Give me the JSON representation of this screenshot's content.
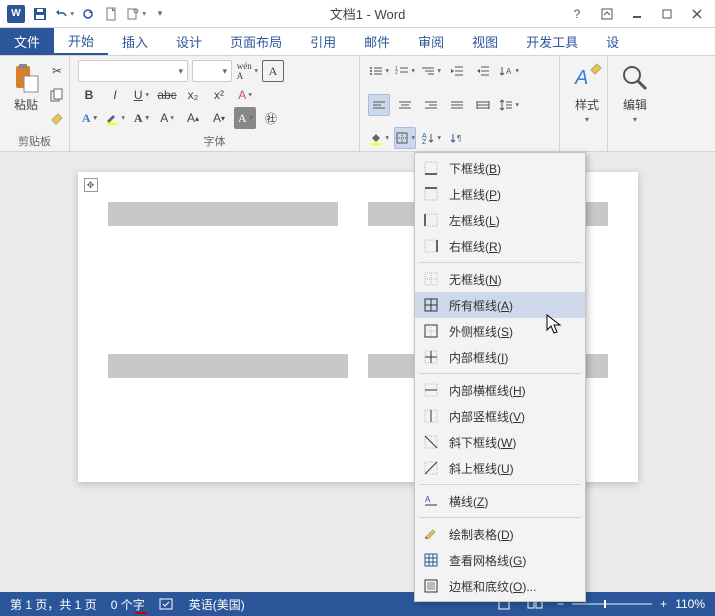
{
  "titlebar": {
    "title": "文档1 - Word"
  },
  "tabs": {
    "file": "文件",
    "home": "开始",
    "insert": "插入",
    "design": "设计",
    "layout": "页面布局",
    "references": "引用",
    "mail": "邮件",
    "review": "审阅",
    "view": "视图",
    "dev": "开发工具",
    "settings": "设"
  },
  "groups": {
    "clipboard": {
      "label": "剪贴板",
      "paste": "粘贴"
    },
    "font": {
      "label": "字体"
    },
    "styles": {
      "label": "样式",
      "btn": "样式"
    },
    "edit": {
      "label": "",
      "btn": "编辑"
    }
  },
  "statusbar": {
    "page": "第 1 页，共 1 页",
    "words": "0 个字",
    "lang": "英语(美国)",
    "zoom": "110%"
  },
  "border_menu": [
    {
      "id": "bottom",
      "label": "下框线",
      "accel": "B",
      "icon": "bb"
    },
    {
      "id": "top",
      "label": "上框线",
      "accel": "P",
      "icon": "bt"
    },
    {
      "id": "left",
      "label": "左框线",
      "accel": "L",
      "icon": "bl"
    },
    {
      "id": "right",
      "label": "右框线",
      "accel": "R",
      "icon": "br"
    },
    {
      "id": "sep"
    },
    {
      "id": "none",
      "label": "无框线",
      "accel": "N",
      "icon": "bn"
    },
    {
      "id": "all",
      "label": "所有框线",
      "accel": "A",
      "icon": "ba",
      "hover": true
    },
    {
      "id": "outside",
      "label": "外侧框线",
      "accel": "S",
      "icon": "bo"
    },
    {
      "id": "inside",
      "label": "内部框线",
      "accel": "I",
      "icon": "bi"
    },
    {
      "id": "sep"
    },
    {
      "id": "ihor",
      "label": "内部横框线",
      "accel": "H",
      "icon": "bh"
    },
    {
      "id": "iver",
      "label": "内部竖框线",
      "accel": "V",
      "icon": "bv"
    },
    {
      "id": "ddown",
      "label": "斜下框线",
      "accel": "W",
      "icon": "bdd"
    },
    {
      "id": "dup",
      "label": "斜上框线",
      "accel": "U",
      "icon": "bdu"
    },
    {
      "id": "sep"
    },
    {
      "id": "hline",
      "label": "横线",
      "accel": "Z",
      "icon": "hl"
    },
    {
      "id": "sep"
    },
    {
      "id": "draw",
      "label": "绘制表格",
      "accel": "D",
      "icon": "dr"
    },
    {
      "id": "grid",
      "label": "查看网格线",
      "accel": "G",
      "icon": "gr"
    },
    {
      "id": "dialog",
      "label": "边框和底纹",
      "accel": "O",
      "icon": "dlg",
      "ellipsis": true
    }
  ]
}
